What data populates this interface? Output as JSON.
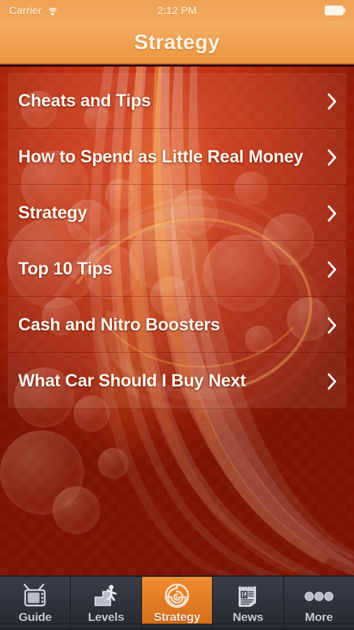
{
  "status_bar": {
    "carrier": "Carrier",
    "wifi_icon": "wifi-icon",
    "time": "2:12 PM",
    "battery_icon": "battery-full-icon"
  },
  "nav_bar": {
    "title": "Strategy"
  },
  "list": {
    "rows": [
      {
        "label": "Cheats and Tips",
        "accessory": "chevron-right-icon"
      },
      {
        "label": "How to Spend as Little Real Money",
        "accessory": "chevron-right-icon"
      },
      {
        "label": "Strategy",
        "accessory": "chevron-right-icon"
      },
      {
        "label": "Top 10 Tips",
        "accessory": "chevron-right-icon"
      },
      {
        "label": "Cash and Nitro Boosters",
        "accessory": "chevron-right-icon"
      },
      {
        "label": "What Car Should I Buy Next",
        "accessory": "chevron-right-icon"
      }
    ]
  },
  "tab_bar": {
    "tabs": [
      {
        "label": "Guide",
        "icon": "television-icon",
        "active": false
      },
      {
        "label": "Levels",
        "icon": "stairs-climb-icon",
        "active": false
      },
      {
        "label": "Strategy",
        "icon": "maze-icon",
        "active": true
      },
      {
        "label": "News",
        "icon": "newspaper-icon",
        "active": false
      },
      {
        "label": "More",
        "icon": "ellipsis-icon",
        "active": false
      }
    ]
  },
  "colors": {
    "nav_accent": "#f0a152",
    "active_tab": "#e07a22",
    "content_red": "#c02f10",
    "tab_bar_dark": "#2f3238",
    "text_light": "#fdf5ea"
  }
}
